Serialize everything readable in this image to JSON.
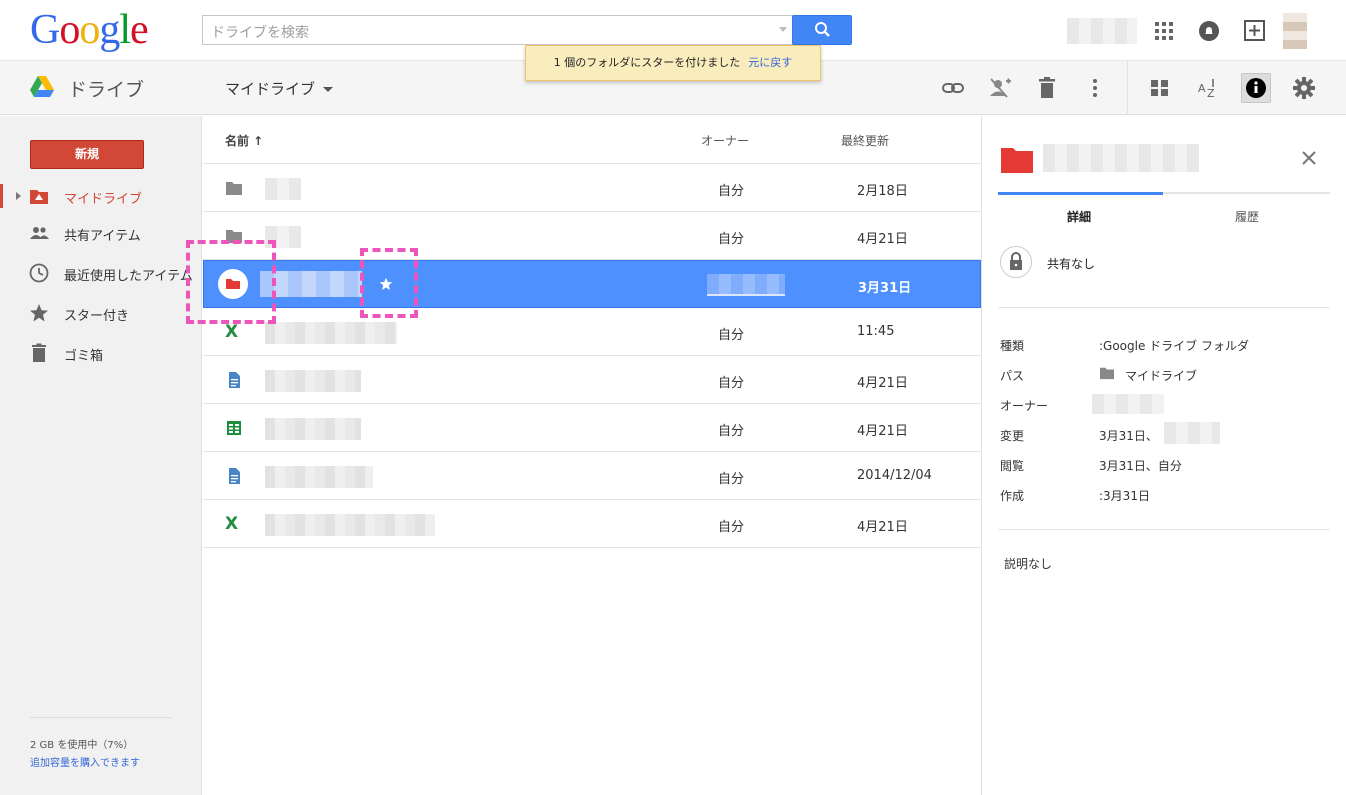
{
  "header": {
    "logo_text": "Google",
    "search_placeholder": "ドライブを検索",
    "toast_message": "1 個のフォルダにスターを付けました",
    "toast_undo": "元に戻す"
  },
  "toolbar": {
    "app_title": "ドライブ",
    "location_label": "マイドライブ"
  },
  "sidebar": {
    "new_label": "新規",
    "items": [
      {
        "label": "マイドライブ",
        "icon": "my-drive-icon",
        "active": true
      },
      {
        "label": "共有アイテム",
        "icon": "people-icon"
      },
      {
        "label": "最近使用したアイテム",
        "icon": "clock-icon"
      },
      {
        "label": "スター付き",
        "icon": "star-icon"
      },
      {
        "label": "ゴミ箱",
        "icon": "trash-icon"
      }
    ],
    "quota_text": "2 GB を使用中（7%）",
    "quota_link": "追加容量を購入できます"
  },
  "list": {
    "headers": {
      "name": "名前 ↑",
      "owner": "オーナー",
      "modified": "最終更新"
    },
    "rows": [
      {
        "type": "folder",
        "owner": "自分",
        "modified": "2月18日"
      },
      {
        "type": "folder",
        "owner": "自分",
        "modified": "4月21日"
      },
      {
        "type": "folder-red",
        "owner": "",
        "modified": "3月31日",
        "selected": true,
        "starred": true
      },
      {
        "type": "excel",
        "owner": "自分",
        "modified": "11:45"
      },
      {
        "type": "doc",
        "owner": "自分",
        "modified": "4月21日"
      },
      {
        "type": "sheet",
        "owner": "自分",
        "modified": "4月21日"
      },
      {
        "type": "doc",
        "owner": "自分",
        "modified": "2014/12/04"
      },
      {
        "type": "excel",
        "owner": "自分",
        "modified": "4月21日"
      }
    ]
  },
  "details": {
    "tabs": [
      "詳細",
      "履歴"
    ],
    "sharing": "共有なし",
    "props": [
      {
        "key": "種類",
        "value": ":Google ドライブ フォルダ"
      },
      {
        "key": "パス",
        "value": "マイドライブ"
      },
      {
        "key": "オーナー",
        "value": ""
      },
      {
        "key": "変更",
        "value": "3月31日、"
      },
      {
        "key": "閲覧",
        "value": "3月31日、自分"
      },
      {
        "key": "作成",
        "value": ":3月31日"
      }
    ],
    "description": "説明なし"
  },
  "colors": {
    "accent_red": "#d14836",
    "selection_blue": "#4d90fe",
    "search_blue": "#4285f4",
    "annotation_pink": "#ee55bb"
  }
}
